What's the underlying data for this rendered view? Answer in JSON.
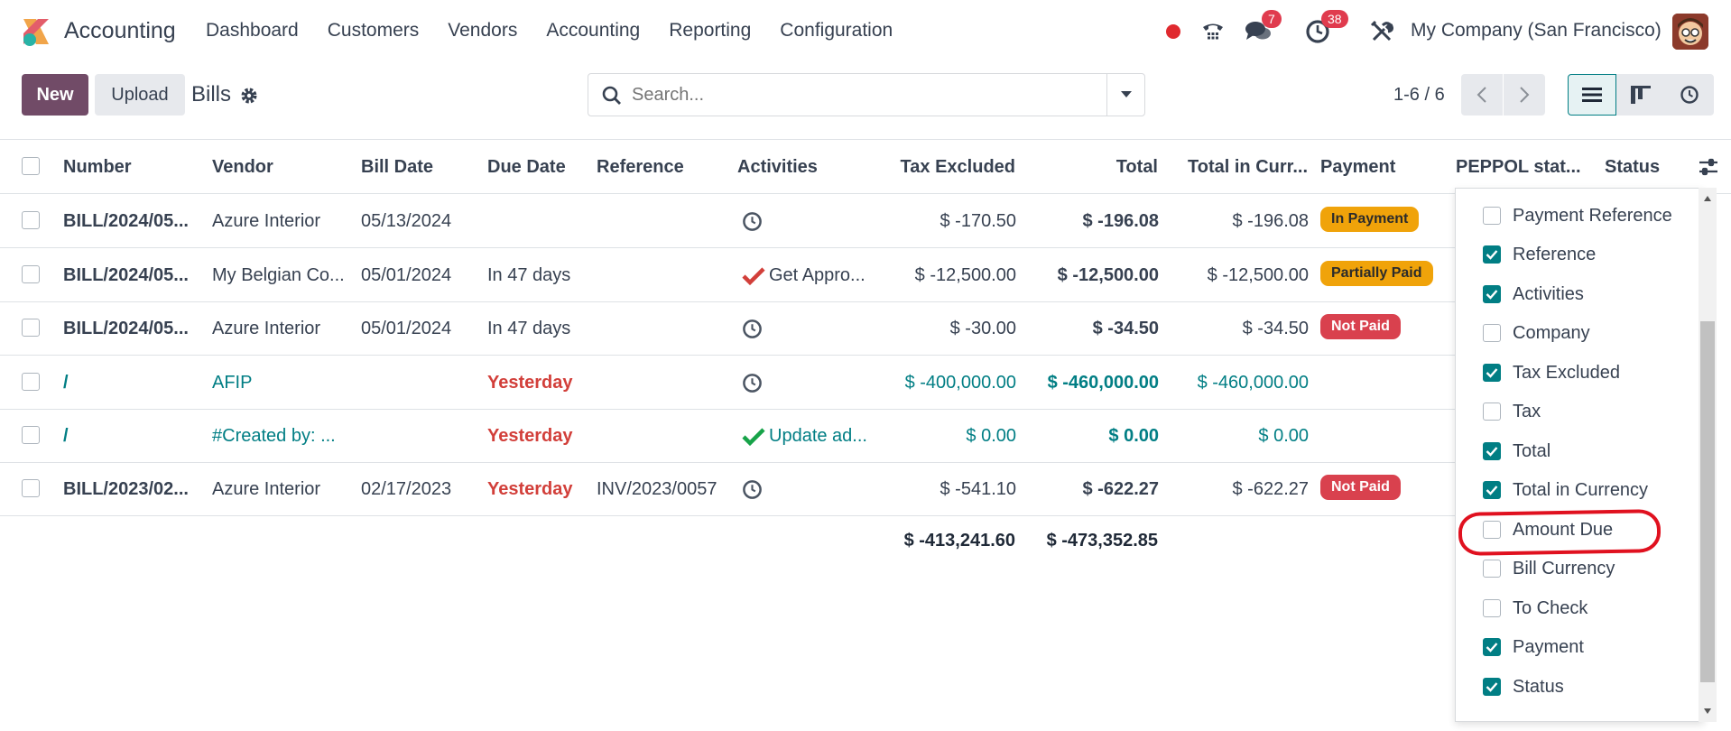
{
  "nav": {
    "app_name": "Accounting",
    "menu": [
      "Dashboard",
      "Customers",
      "Vendors",
      "Accounting",
      "Reporting",
      "Configuration"
    ],
    "messages_badge": "7",
    "activities_badge": "38",
    "company": "My Company (San Francisco)"
  },
  "controls": {
    "new_label": "New",
    "upload_label": "Upload",
    "view_title": "Bills",
    "search_placeholder": "Search...",
    "pager": "1-6 / 6"
  },
  "table": {
    "headers": {
      "number": "Number",
      "vendor": "Vendor",
      "bill_date": "Bill Date",
      "due_date": "Due Date",
      "reference": "Reference",
      "activities": "Activities",
      "tax_excluded": "Tax Excluded",
      "total": "Total",
      "total_currency": "Total in Curr...",
      "payment": "Payment",
      "peppol": "PEPPOL stat...",
      "status": "Status"
    },
    "rows": [
      {
        "number": "BILL/2024/05...",
        "vendor": "Azure Interior",
        "bill_date": "05/13/2024",
        "due_date": "",
        "reference": "",
        "activity": "",
        "tax_excluded": "$ -170.50",
        "total": "$ -196.08",
        "total_currency": "$ -196.08",
        "payment": "In Payment"
      },
      {
        "number": "BILL/2024/05...",
        "vendor": "My Belgian Co...",
        "bill_date": "05/01/2024",
        "due_date": "In 47 days",
        "reference": "",
        "activity": "Get Appro...",
        "tax_excluded": "$ -12,500.00",
        "total": "$ -12,500.00",
        "total_currency": "$ -12,500.00",
        "payment": "Partially Paid"
      },
      {
        "number": "BILL/2024/05...",
        "vendor": "Azure Interior",
        "bill_date": "05/01/2024",
        "due_date": "In 47 days",
        "reference": "",
        "activity": "",
        "tax_excluded": "$ -30.00",
        "total": "$ -34.50",
        "total_currency": "$ -34.50",
        "payment": "Not Paid"
      },
      {
        "number": "/",
        "vendor": "AFIP",
        "bill_date": "",
        "due_date": "Yesterday",
        "reference": "",
        "activity": "",
        "tax_excluded": "$ -400,000.00",
        "total": "$ -460,000.00",
        "total_currency": "$ -460,000.00",
        "payment": ""
      },
      {
        "number": "/",
        "vendor": "#Created by: ...",
        "bill_date": "",
        "due_date": "Yesterday",
        "reference": "",
        "activity": "Update ad...",
        "tax_excluded": "$ 0.00",
        "total": "$ 0.00",
        "total_currency": "$ 0.00",
        "payment": ""
      },
      {
        "number": "BILL/2023/02...",
        "vendor": "Azure Interior",
        "bill_date": "02/17/2023",
        "due_date": "Yesterday",
        "reference": "INV/2023/0057",
        "activity": "",
        "tax_excluded": "$ -541.10",
        "total": "$ -622.27",
        "total_currency": "$ -622.27",
        "payment": "Not Paid"
      }
    ],
    "totals": {
      "tax_excluded": "$ -413,241.60",
      "total": "$ -473,352.85"
    }
  },
  "optional_columns": [
    {
      "label": "Payment Reference",
      "checked": false
    },
    {
      "label": "Reference",
      "checked": true
    },
    {
      "label": "Activities",
      "checked": true
    },
    {
      "label": "Company",
      "checked": false
    },
    {
      "label": "Tax Excluded",
      "checked": true
    },
    {
      "label": "Tax",
      "checked": false
    },
    {
      "label": "Total",
      "checked": true
    },
    {
      "label": "Total in Currency",
      "checked": true
    },
    {
      "label": "Amount Due",
      "checked": false
    },
    {
      "label": "Bill Currency",
      "checked": false
    },
    {
      "label": "To Check",
      "checked": false
    },
    {
      "label": "Payment",
      "checked": true
    },
    {
      "label": "Status",
      "checked": true
    }
  ],
  "colors": {
    "brand": "#714b67",
    "accent": "#017e84",
    "danger": "#d9414e",
    "warning": "#f0a30a"
  }
}
